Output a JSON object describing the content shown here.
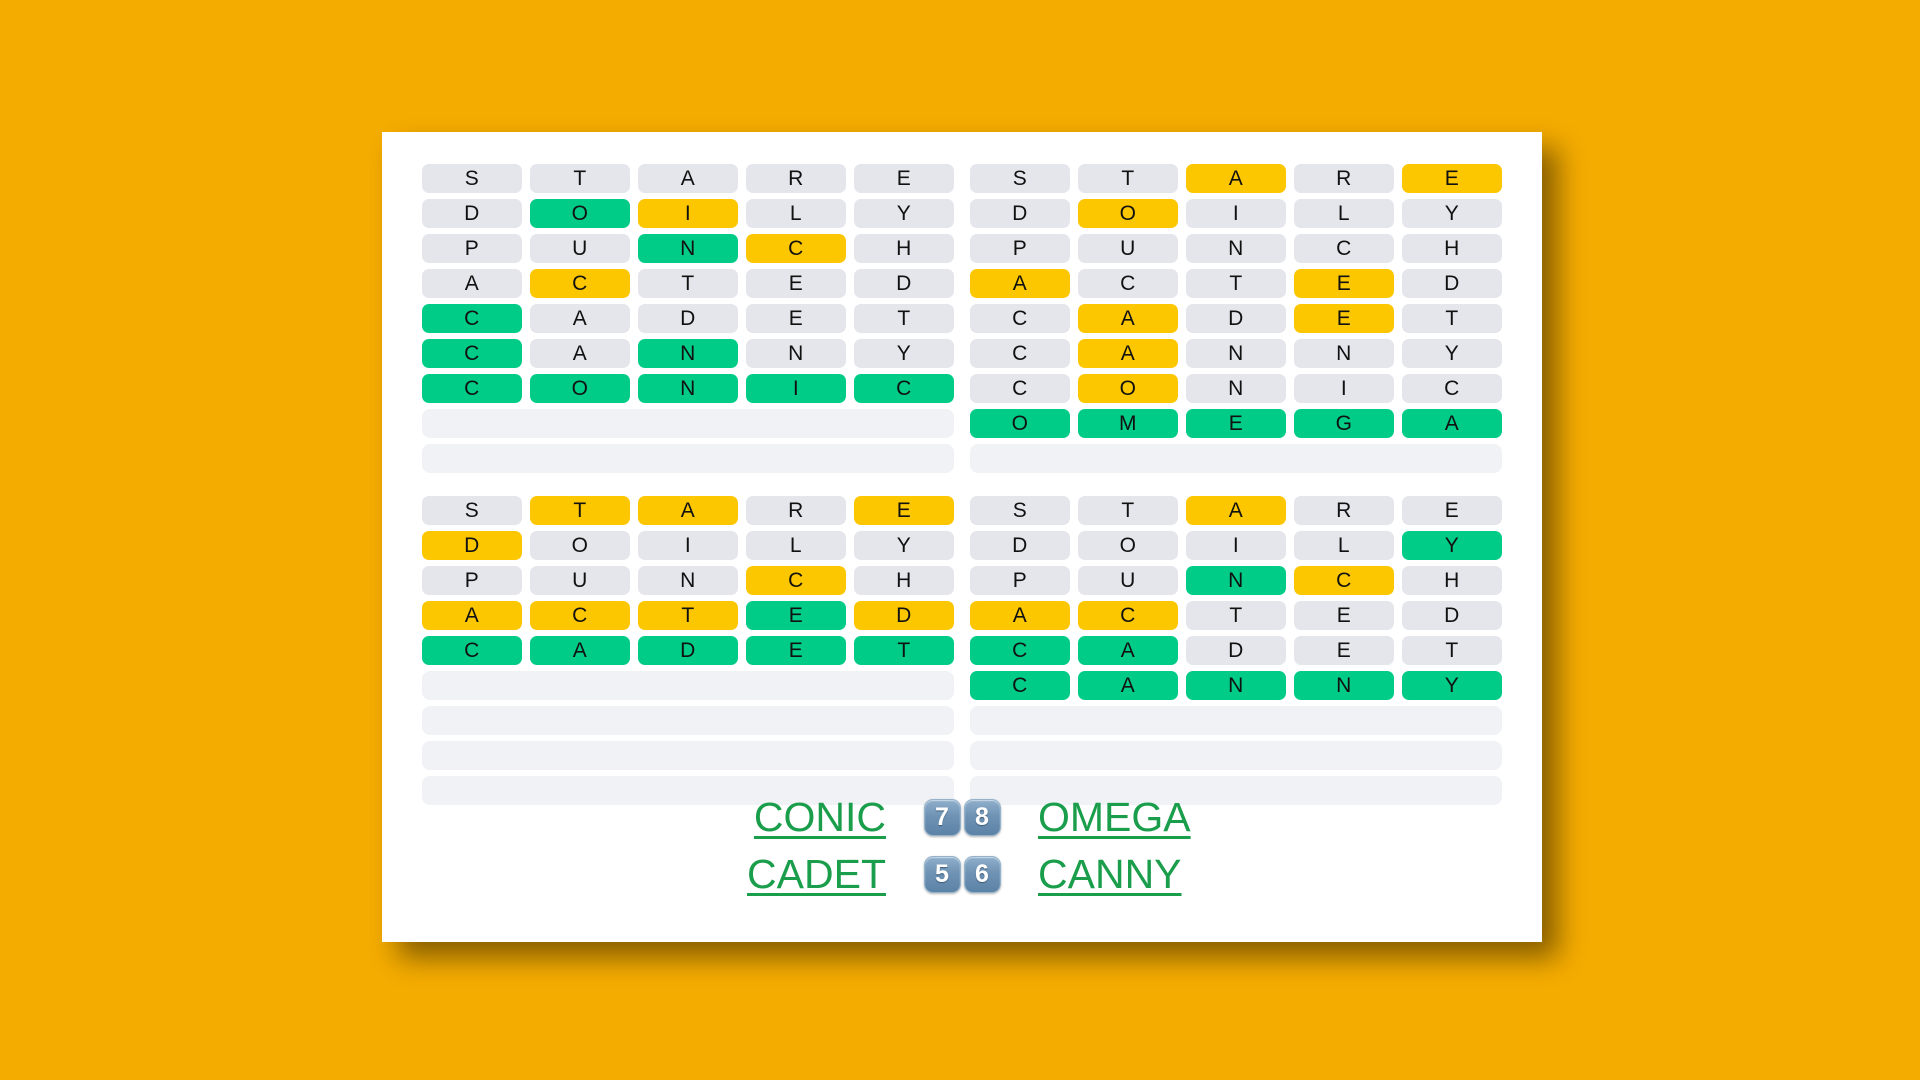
{
  "theme": {
    "background": "#f5ac00",
    "card": "#ffffff",
    "absent": "#e4e6eb",
    "present": "#fdc700",
    "correct": "#00cc88",
    "blank": "#f0f2f6",
    "answer_link": "#1a9e4b",
    "badge": "#6f93b4"
  },
  "grids": [
    {
      "id": "quadrant-top-left",
      "solved_word": "CONIC",
      "rows": [
        {
          "letters": [
            "S",
            "T",
            "A",
            "R",
            "E"
          ],
          "states": [
            "absent",
            "absent",
            "absent",
            "absent",
            "absent"
          ]
        },
        {
          "letters": [
            "D",
            "O",
            "I",
            "L",
            "Y"
          ],
          "states": [
            "absent",
            "correct",
            "present",
            "absent",
            "absent"
          ]
        },
        {
          "letters": [
            "P",
            "U",
            "N",
            "C",
            "H"
          ],
          "states": [
            "absent",
            "absent",
            "correct",
            "present",
            "absent"
          ]
        },
        {
          "letters": [
            "A",
            "C",
            "T",
            "E",
            "D"
          ],
          "states": [
            "absent",
            "present",
            "absent",
            "absent",
            "absent"
          ]
        },
        {
          "letters": [
            "C",
            "A",
            "D",
            "E",
            "T"
          ],
          "states": [
            "correct",
            "absent",
            "absent",
            "absent",
            "absent"
          ]
        },
        {
          "letters": [
            "C",
            "A",
            "N",
            "N",
            "Y"
          ],
          "states": [
            "correct",
            "absent",
            "correct",
            "absent",
            "absent"
          ]
        },
        {
          "letters": [
            "C",
            "O",
            "N",
            "I",
            "C"
          ],
          "states": [
            "correct",
            "correct",
            "correct",
            "correct",
            "correct"
          ]
        },
        {
          "letters": [
            "",
            "",
            "",
            "",
            ""
          ],
          "states": [
            "blank",
            "blank",
            "blank",
            "blank",
            "blank"
          ],
          "empty": true
        },
        {
          "letters": [
            "",
            "",
            "",
            "",
            ""
          ],
          "states": [
            "blank",
            "blank",
            "blank",
            "blank",
            "blank"
          ],
          "empty": true
        }
      ]
    },
    {
      "id": "quadrant-top-right",
      "solved_word": "OMEGA",
      "rows": [
        {
          "letters": [
            "S",
            "T",
            "A",
            "R",
            "E"
          ],
          "states": [
            "absent",
            "absent",
            "present",
            "absent",
            "present"
          ]
        },
        {
          "letters": [
            "D",
            "O",
            "I",
            "L",
            "Y"
          ],
          "states": [
            "absent",
            "present",
            "absent",
            "absent",
            "absent"
          ]
        },
        {
          "letters": [
            "P",
            "U",
            "N",
            "C",
            "H"
          ],
          "states": [
            "absent",
            "absent",
            "absent",
            "absent",
            "absent"
          ]
        },
        {
          "letters": [
            "A",
            "C",
            "T",
            "E",
            "D"
          ],
          "states": [
            "present",
            "absent",
            "absent",
            "present",
            "absent"
          ]
        },
        {
          "letters": [
            "C",
            "A",
            "D",
            "E",
            "T"
          ],
          "states": [
            "absent",
            "present",
            "absent",
            "present",
            "absent"
          ]
        },
        {
          "letters": [
            "C",
            "A",
            "N",
            "N",
            "Y"
          ],
          "states": [
            "absent",
            "present",
            "absent",
            "absent",
            "absent"
          ]
        },
        {
          "letters": [
            "C",
            "O",
            "N",
            "I",
            "C"
          ],
          "states": [
            "absent",
            "present",
            "absent",
            "absent",
            "absent"
          ]
        },
        {
          "letters": [
            "O",
            "M",
            "E",
            "G",
            "A"
          ],
          "states": [
            "correct",
            "correct",
            "correct",
            "correct",
            "correct"
          ]
        },
        {
          "letters": [
            "",
            "",
            "",
            "",
            ""
          ],
          "states": [
            "blank",
            "blank",
            "blank",
            "blank",
            "blank"
          ],
          "empty": true
        }
      ]
    },
    {
      "id": "quadrant-bottom-left",
      "solved_word": "CADET",
      "rows": [
        {
          "letters": [
            "S",
            "T",
            "A",
            "R",
            "E"
          ],
          "states": [
            "absent",
            "present",
            "present",
            "absent",
            "present"
          ]
        },
        {
          "letters": [
            "D",
            "O",
            "I",
            "L",
            "Y"
          ],
          "states": [
            "present",
            "absent",
            "absent",
            "absent",
            "absent"
          ]
        },
        {
          "letters": [
            "P",
            "U",
            "N",
            "C",
            "H"
          ],
          "states": [
            "absent",
            "absent",
            "absent",
            "present",
            "absent"
          ]
        },
        {
          "letters": [
            "A",
            "C",
            "T",
            "E",
            "D"
          ],
          "states": [
            "present",
            "present",
            "present",
            "correct",
            "present"
          ]
        },
        {
          "letters": [
            "C",
            "A",
            "D",
            "E",
            "T"
          ],
          "states": [
            "correct",
            "correct",
            "correct",
            "correct",
            "correct"
          ]
        },
        {
          "letters": [
            "",
            "",
            "",
            "",
            ""
          ],
          "states": [
            "blank",
            "blank",
            "blank",
            "blank",
            "blank"
          ],
          "empty": true
        },
        {
          "letters": [
            "",
            "",
            "",
            "",
            ""
          ],
          "states": [
            "blank",
            "blank",
            "blank",
            "blank",
            "blank"
          ],
          "empty": true
        },
        {
          "letters": [
            "",
            "",
            "",
            "",
            ""
          ],
          "states": [
            "blank",
            "blank",
            "blank",
            "blank",
            "blank"
          ],
          "empty": true
        },
        {
          "letters": [
            "",
            "",
            "",
            "",
            ""
          ],
          "states": [
            "blank",
            "blank",
            "blank",
            "blank",
            "blank"
          ],
          "empty": true
        }
      ]
    },
    {
      "id": "quadrant-bottom-right",
      "solved_word": "CANNY",
      "rows": [
        {
          "letters": [
            "S",
            "T",
            "A",
            "R",
            "E"
          ],
          "states": [
            "absent",
            "absent",
            "present",
            "absent",
            "absent"
          ]
        },
        {
          "letters": [
            "D",
            "O",
            "I",
            "L",
            "Y"
          ],
          "states": [
            "absent",
            "absent",
            "absent",
            "absent",
            "correct"
          ]
        },
        {
          "letters": [
            "P",
            "U",
            "N",
            "C",
            "H"
          ],
          "states": [
            "absent",
            "absent",
            "correct",
            "present",
            "absent"
          ]
        },
        {
          "letters": [
            "A",
            "C",
            "T",
            "E",
            "D"
          ],
          "states": [
            "present",
            "present",
            "absent",
            "absent",
            "absent"
          ]
        },
        {
          "letters": [
            "C",
            "A",
            "D",
            "E",
            "T"
          ],
          "states": [
            "correct",
            "correct",
            "absent",
            "absent",
            "absent"
          ]
        },
        {
          "letters": [
            "C",
            "A",
            "N",
            "N",
            "Y"
          ],
          "states": [
            "correct",
            "correct",
            "correct",
            "correct",
            "correct"
          ]
        },
        {
          "letters": [
            "",
            "",
            "",
            "",
            ""
          ],
          "states": [
            "blank",
            "blank",
            "blank",
            "blank",
            "blank"
          ],
          "empty": true
        },
        {
          "letters": [
            "",
            "",
            "",
            "",
            ""
          ],
          "states": [
            "blank",
            "blank",
            "blank",
            "blank",
            "blank"
          ],
          "empty": true
        },
        {
          "letters": [
            "",
            "",
            "",
            "",
            ""
          ],
          "states": [
            "blank",
            "blank",
            "blank",
            "blank",
            "blank"
          ],
          "empty": true
        }
      ]
    }
  ],
  "footer": {
    "lines": [
      {
        "left_word": "CONIC",
        "badges": [
          "7",
          "8"
        ],
        "right_word": "OMEGA"
      },
      {
        "left_word": "CADET",
        "badges": [
          "5",
          "6"
        ],
        "right_word": "CANNY"
      }
    ]
  }
}
